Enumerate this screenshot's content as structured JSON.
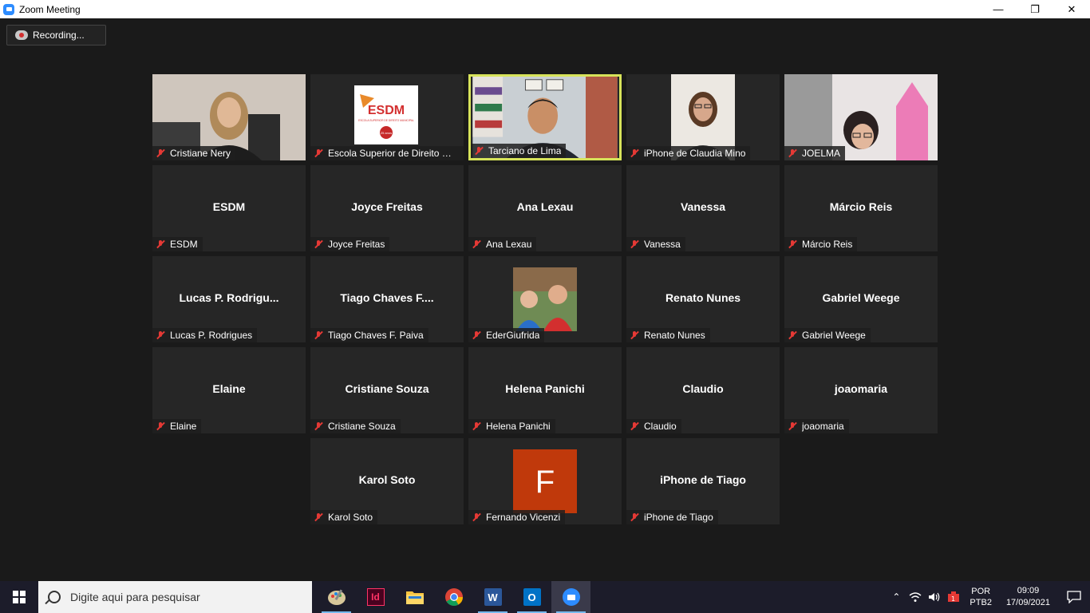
{
  "window": {
    "title": "Zoom Meeting",
    "minimize": "—",
    "restore": "❐",
    "close": "✕"
  },
  "recording": {
    "label": "Recording..."
  },
  "tiles": [
    {
      "label": "Cristiane Nery",
      "center": "",
      "video": "woman-dark"
    },
    {
      "label": "Escola Superior de Direito Mu...",
      "center": "",
      "video": "esdm-logo"
    },
    {
      "label": "Tarciano de Lima",
      "center": "",
      "video": "man-office",
      "active": true
    },
    {
      "label": "iPhone de Claudia Mino",
      "center": "",
      "video": "woman-glasses"
    },
    {
      "label": "JOELMA",
      "center": "",
      "video": "woman-room"
    },
    {
      "label": "ESDM",
      "center": "ESDM"
    },
    {
      "label": "Joyce Freitas",
      "center": "Joyce Freitas"
    },
    {
      "label": "Ana Lexau",
      "center": "Ana Lexau"
    },
    {
      "label": "Vanessa",
      "center": "Vanessa"
    },
    {
      "label": "Márcio Reis",
      "center": "Márcio Reis"
    },
    {
      "label": "Lucas P. Rodrigues",
      "center": "Lucas  P. Rodrigu..."
    },
    {
      "label": "Tiago Chaves F. Paiva",
      "center": "Tiago  Chaves  F...."
    },
    {
      "label": "EderGiufrida",
      "center": "",
      "video": "family-photo"
    },
    {
      "label": "Renato Nunes",
      "center": "Renato Nunes"
    },
    {
      "label": "Gabriel Weege",
      "center": "Gabriel Weege"
    },
    {
      "label": "Elaine",
      "center": "Elaine"
    },
    {
      "label": "Cristiane Souza",
      "center": "Cristiane Souza"
    },
    {
      "label": "Helena Panichi",
      "center": "Helena Panichi"
    },
    {
      "label": "Claudio",
      "center": "Claudio"
    },
    {
      "label": "joaomaria",
      "center": "joaomaria"
    },
    {
      "label": "Karol Soto",
      "center": "Karol Soto"
    },
    {
      "label": "Fernando Vicenzi",
      "center": "",
      "video": "avatar-f",
      "avatar_letter": "F"
    },
    {
      "label": "iPhone de Tiago",
      "center": "iPhone de Tiago"
    }
  ],
  "esdm_logo": {
    "text": "ESDM",
    "sub": "ESCOLA SUPERIOR DE DIREITO MUNICIPAL",
    "badge": "25 anos"
  },
  "taskbar": {
    "search_placeholder": "Digite aqui para pesquisar",
    "lang_line1": "POR",
    "lang_line2": "PTB2",
    "time": "09:09",
    "date": "17/09/2021",
    "apps": [
      "paint-icon",
      "indesign-icon",
      "file-explorer-icon",
      "chrome-icon",
      "word-icon",
      "outlook-icon",
      "zoom-icon"
    ],
    "indesign_label": "Id",
    "word_label": "W",
    "outlook_label": "O"
  },
  "colors": {
    "active_border": "#d7e35a",
    "mute_red": "#e53935",
    "avatar_bg": "#c0390b"
  }
}
